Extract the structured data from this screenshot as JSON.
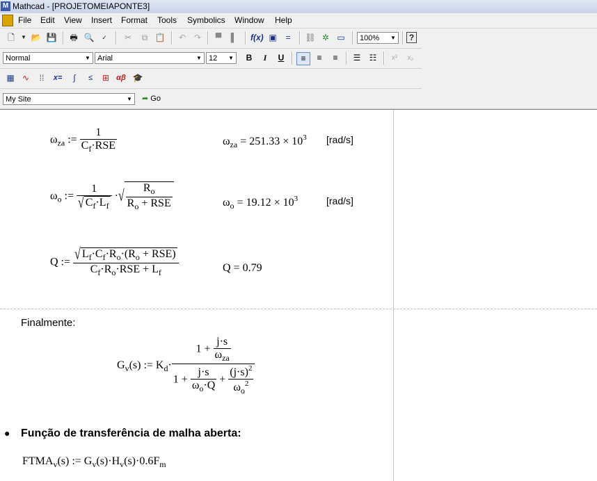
{
  "window": {
    "title": "Mathcad - [PROJETOMEIAPONTE3]"
  },
  "menu": [
    "File",
    "Edit",
    "View",
    "Insert",
    "Format",
    "Tools",
    "Symbolics",
    "Window",
    "Help"
  ],
  "toolbar": {
    "zoom": "100%",
    "style": "Normal",
    "font": "Arial",
    "size": "12",
    "bold": "B",
    "italic": "I",
    "underline": "U",
    "site": "My Site",
    "go": "Go"
  },
  "doc": {
    "wza_lhs": "ω",
    "wza_sub": "za",
    "wza_num": "1",
    "wza_den": "C",
    "wza_res": "251.33",
    "wza_exp": "3",
    "unit1": "[rad/s]",
    "wo_res": "19.12",
    "wo_exp": "3",
    "unit2": "[rad/s]",
    "q_res": "0.79",
    "finalmente": "Finalmente:",
    "bullet_text": "Função de transferência de malha aberta:"
  }
}
